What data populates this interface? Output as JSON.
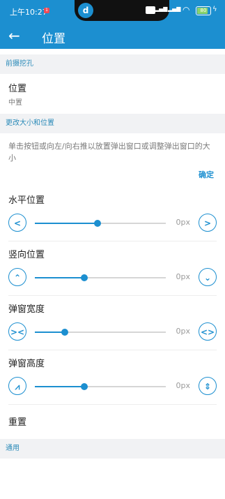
{
  "status": {
    "time": "上午10:27",
    "notif_badge": "1",
    "battery": "80"
  },
  "appbar": {
    "title": "位置"
  },
  "sections": {
    "header1": "前摄挖孔",
    "header2": "更改大小和位置",
    "header3": "通用"
  },
  "position_pref": {
    "title": "位置",
    "summary": "中置"
  },
  "description": "单击按钮或向左/向右推以放置弹出窗口或调整弹出窗口的大小",
  "confirm_label": "确定",
  "sliders": [
    {
      "label": "水平位置",
      "value_text": "0px",
      "fraction": 0.48,
      "left_icon": "chevron-left-icon",
      "right_icon": "chevron-right-icon"
    },
    {
      "label": "竖向位置",
      "value_text": "0px",
      "fraction": 0.38,
      "left_icon": "chevron-up-icon",
      "right_icon": "chevron-down-icon"
    },
    {
      "label": "弹窗宽度",
      "value_text": "0px",
      "fraction": 0.23,
      "left_icon": "shrink-horizontal-icon",
      "right_icon": "expand-horizontal-icon"
    },
    {
      "label": "弹窗高度",
      "value_text": "0px",
      "fraction": 0.38,
      "left_icon": "shrink-vertical-icon",
      "right_icon": "expand-vertical-icon"
    }
  ],
  "reset_label": "重置",
  "colors": {
    "accent": "#1c8fd0",
    "section_text": "#2a8ab8"
  }
}
